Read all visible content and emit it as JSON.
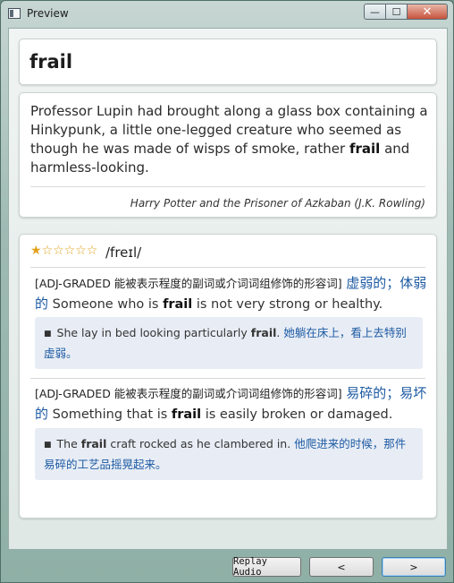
{
  "window": {
    "title": "Preview"
  },
  "caption": {
    "minimize": "—",
    "maximize": "☐",
    "close": "✕"
  },
  "word": "frail",
  "context": {
    "before": "Professor Lupin had brought along a glass box containing a Hinkypunk, a little one-legged creature who seemed as though he was made of wisps of smoke, rather ",
    "highlight": "frail",
    "after": " and harmless-looking.",
    "source": "Harry Potter and the Prisoner of Azkaban (J.K. Rowling)"
  },
  "entry": {
    "rating_filled": "★",
    "rating_empty": "☆☆☆☆☆",
    "rating_value": 1,
    "rating_max": 6,
    "phonetic": "/freɪl/",
    "senses": [
      {
        "grammar": "[ADJ-GRADED 能被表示程度的副词或介词词组修饰的形容词]",
        "zh": "虚弱的；体弱的",
        "def_before": " Someone who is ",
        "def_bold": "frail",
        "def_after": " is not very strong or healthy.",
        "example": {
          "bullet": "■",
          "before": "She lay in bed looking particularly ",
          "bold": "frail",
          "after": ". ",
          "zh": "她躺在床上，看上去特别虚弱。"
        }
      },
      {
        "grammar": "[ADJ-GRADED 能被表示程度的副词或介词词组修饰的形容词]",
        "zh": "易碎的；易坏的",
        "def_before": " Something that is ",
        "def_bold": "frail",
        "def_after": " is easily broken or damaged.",
        "example": {
          "bullet": "■",
          "before": "The ",
          "bold": "frail",
          "after": " craft rocked as he clambered in. ",
          "zh": "他爬进来的时候，那件易碎的工艺品摇晃起来。"
        }
      }
    ]
  },
  "buttons": {
    "replay": "Replay Audio",
    "prev": "<",
    "next": ">"
  },
  "colors": {
    "accent_zh": "#1d5aa3",
    "star": "#e3a21a",
    "example_bg": "#e8edf5"
  }
}
